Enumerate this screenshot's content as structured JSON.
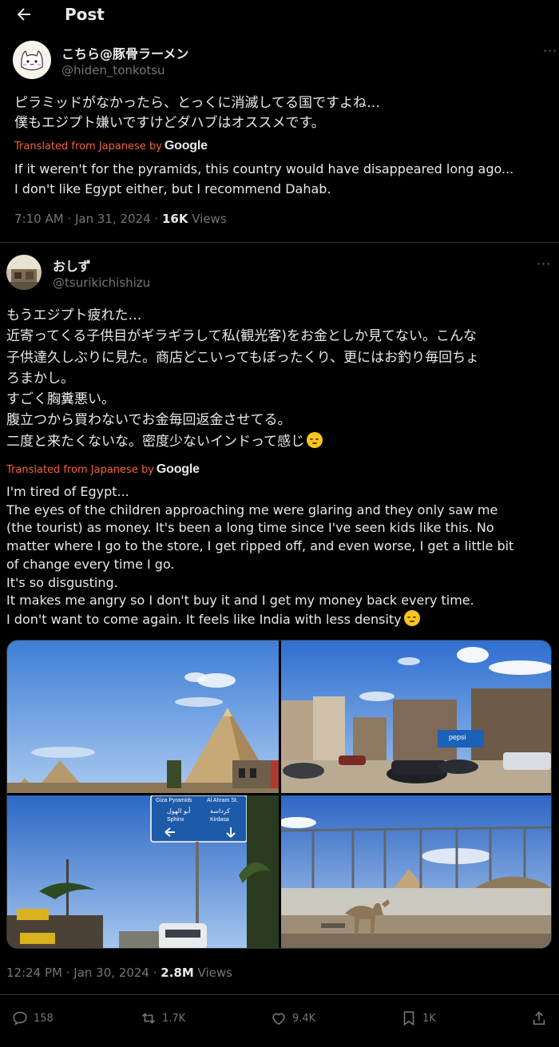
{
  "header": {
    "title": "Post",
    "back_icon": "arrow-left-icon"
  },
  "post1": {
    "display_name": "こちら@豚骨ラーメン",
    "handle": "@hiden_tonkotsu",
    "text_lines": [
      "ピラミッドがなかったら、とっくに消滅してる国ですよね…",
      "僕もエジプト嫌いですけどダハブはオススメです。"
    ],
    "translated_label": "Translated from Japanese by",
    "translated_brand": "Google",
    "translation_lines": [
      "If it weren't for the pyramids, this country would have disappeared long ago...",
      "I don't like Egypt either, but I recommend Dahab."
    ],
    "timestamp": "7:10 AM · Jan 31, 2024 · ",
    "views_count": "16K",
    "views_label": " Views"
  },
  "post2": {
    "display_name": "おしず",
    "handle": "@tsurikichishizu",
    "text_lines": [
      "もうエジプト疲れた…",
      "近寄ってくる子供目がギラギラして私(観光客)をお金としか見てない。こんな",
      "子供達久しぶりに見た。商店どこいってもぼったくり、更にはお釣り毎回ちょ",
      "ろまかし。",
      "すごく胸糞悪い。",
      "腹立つから買わないでお金毎回返金させてる。",
      "二度と来たくないな。密度少ないインドって感じ"
    ],
    "translated_label": "Translated from Japanese by",
    "translated_brand": "Google",
    "translation_lines": [
      "I'm tired of Egypt...",
      "The eyes of the children approaching me were glaring and they only saw me",
      "(the tourist) as money. It's been a long time since I've seen kids like this. No",
      "matter where I go to the store, I get ripped off, and even worse, I get a little bit",
      "of change every time I go.",
      "It's so disgusting.",
      "It makes me angry so I don't buy it and I get my money back every time.",
      "I don't want to come again. It feels like India with less density"
    ],
    "emoji": "relieved-face-emoji",
    "sign_text": {
      "line1": "Giza Pyramids",
      "line2": "Al Ahram St.",
      "left_ar": "أبو الهول",
      "left_en": "Sphinx",
      "right_ar": "كرداسة",
      "right_en": "Kirdasa"
    },
    "shop_sign": "pepsi",
    "timestamp": "12:24 PM · Jan 30, 2024 · ",
    "views_count": "2.8M",
    "views_label": " Views",
    "actions": {
      "replies": "158",
      "reposts": "1.7K",
      "likes": "9.4K",
      "bookmarks": "1K"
    }
  },
  "colors": {
    "background": "#000000",
    "text": "#e7e9ea",
    "muted": "#71767b",
    "translated": "#f4603e",
    "divider": "#2f3336"
  }
}
